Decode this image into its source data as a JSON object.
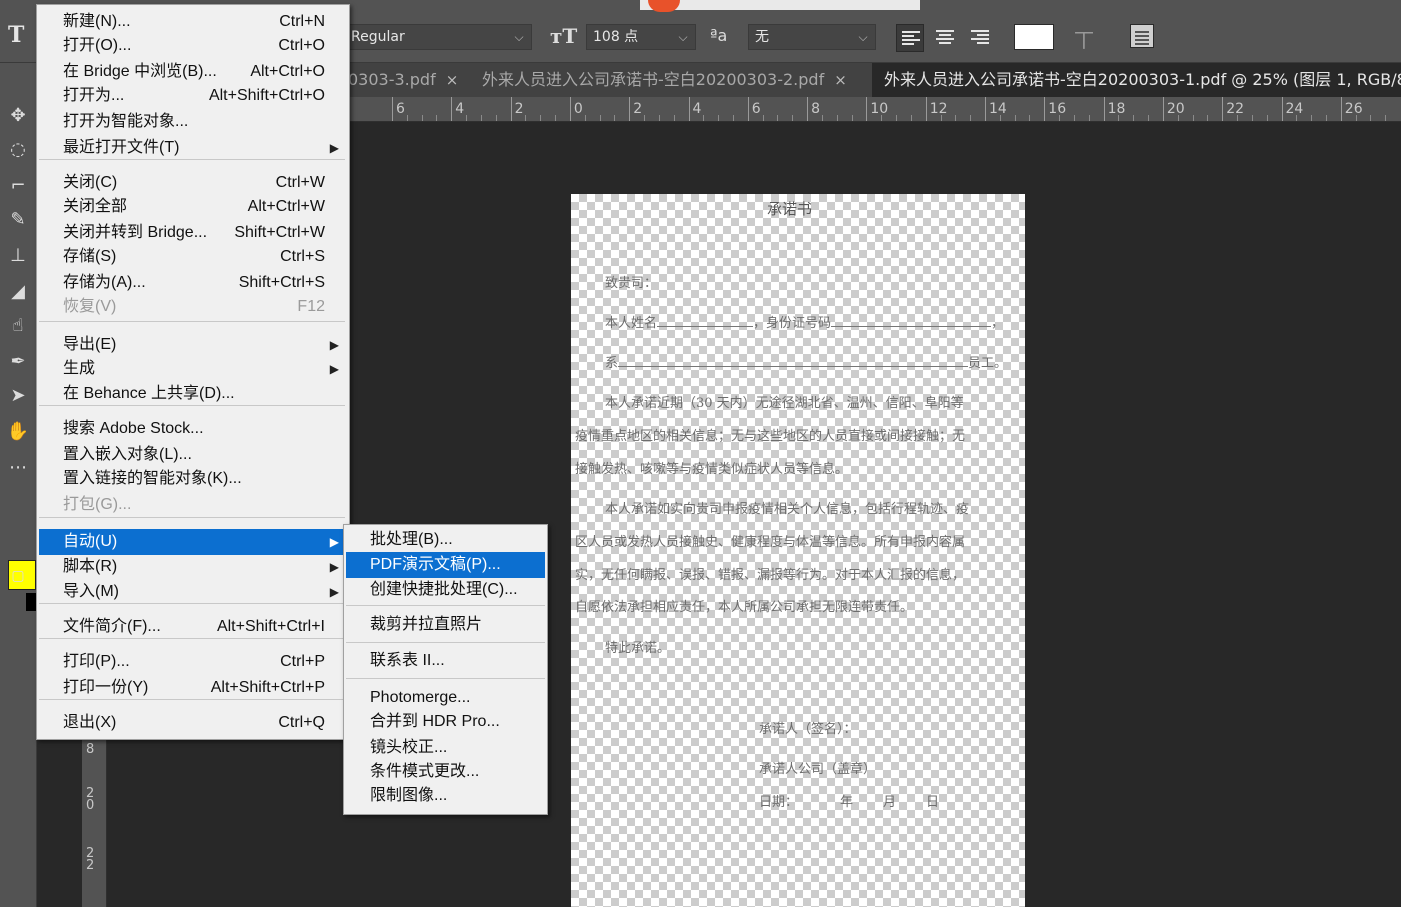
{
  "options_bar": {
    "font_style": "Regular",
    "font_size": "108 点",
    "antialias": "无",
    "color": "#ffffff"
  },
  "tabs": [
    {
      "label": "0303-3.pdf",
      "close": "×"
    },
    {
      "label": "外来人员进入公司承诺书-空白20200303-2.pdf",
      "close": "×"
    },
    {
      "label": "外来人员进入公司承诺书-空白20200303-1.pdf @ 25% (图层 1, RGB/8"
    }
  ],
  "ruler_h": [
    "6",
    "4",
    "2",
    "0",
    "2",
    "4",
    "6",
    "8",
    "10",
    "12",
    "14",
    "16",
    "18",
    "20",
    "22",
    "24",
    "26"
  ],
  "ruler_v": [
    "8",
    "2\n0",
    "2\n2"
  ],
  "file_menu": {
    "items": [
      {
        "label": "新建(N)...",
        "shortcut": "Ctrl+N"
      },
      {
        "label": "打开(O)...",
        "shortcut": "Ctrl+O"
      },
      {
        "label": "在 Bridge 中浏览(B)...",
        "shortcut": "Alt+Ctrl+O"
      },
      {
        "label": "打开为...",
        "shortcut": "Alt+Shift+Ctrl+O"
      },
      {
        "label": "打开为智能对象...",
        "shortcut": ""
      },
      {
        "label": "最近打开文件(T)",
        "shortcut": ""
      },
      {
        "label": "关闭(C)",
        "shortcut": "Ctrl+W"
      },
      {
        "label": "关闭全部",
        "shortcut": "Alt+Ctrl+W"
      },
      {
        "label": "关闭并转到 Bridge...",
        "shortcut": "Shift+Ctrl+W"
      },
      {
        "label": "存储(S)",
        "shortcut": "Ctrl+S"
      },
      {
        "label": "存储为(A)...",
        "shortcut": "Shift+Ctrl+S"
      },
      {
        "label": "恢复(V)",
        "shortcut": "F12"
      },
      {
        "label": "导出(E)",
        "shortcut": ""
      },
      {
        "label": "生成",
        "shortcut": ""
      },
      {
        "label": "在 Behance 上共享(D)...",
        "shortcut": ""
      },
      {
        "label": "搜索 Adobe Stock...",
        "shortcut": ""
      },
      {
        "label": "置入嵌入对象(L)...",
        "shortcut": ""
      },
      {
        "label": "置入链接的智能对象(K)...",
        "shortcut": ""
      },
      {
        "label": "打包(G)...",
        "shortcut": ""
      },
      {
        "label": "自动(U)",
        "shortcut": ""
      },
      {
        "label": "脚本(R)",
        "shortcut": ""
      },
      {
        "label": "导入(M)",
        "shortcut": ""
      },
      {
        "label": "文件简介(F)...",
        "shortcut": "Alt+Shift+Ctrl+I"
      },
      {
        "label": "打印(P)...",
        "shortcut": "Ctrl+P"
      },
      {
        "label": "打印一份(Y)",
        "shortcut": "Alt+Shift+Ctrl+P"
      },
      {
        "label": "退出(X)",
        "shortcut": "Ctrl+Q"
      }
    ]
  },
  "auto_submenu": {
    "items": [
      {
        "label": "批处理(B)..."
      },
      {
        "label": "PDF演示文稿(P)..."
      },
      {
        "label": "创建快捷批处理(C)..."
      },
      {
        "label": "裁剪并拉直照片"
      },
      {
        "label": "联系表 II..."
      },
      {
        "label": "Photomerge..."
      },
      {
        "label": "合并到 HDR Pro..."
      },
      {
        "label": "镜头校正..."
      },
      {
        "label": "条件模式更改..."
      },
      {
        "label": "限制图像..."
      }
    ]
  },
  "document": {
    "title": "承诺书",
    "greeting": "致贵司：",
    "line1_a": "本人姓名",
    "line1_b": "，身份证号码",
    "line2_a": "系",
    "line2_b": "员工。",
    "p1_l1": "本人承诺近期（30 天内）无途径湖北省、温州、信阳、阜阳等",
    "p1_l2": "疫情重点地区的相关信息；无与这些地区的人员直接或间接接触；无",
    "p1_l3": "接触发热、咳嗽等与疫情类似症状人员等信息。",
    "p2_l1": "本人承诺如实向贵司申报疫情相关个人信息，包括行程轨迹、疫",
    "p2_l2": "区人员或发热人员接触史、健康程度与体温等信息。所有申报内容属",
    "p2_l3": "实，无任何瞒报、误报、错报、漏报等行为。对于本人汇报的信息，",
    "p2_l4": "自愿依法承担相应责任，本人所属公司承担无限连带责任。",
    "closing": "特此承诺。",
    "sign": "承诺人（签名）：",
    "company": "承诺人公司（盖章）",
    "date_label": "日期：",
    "date_y": "年",
    "date_m": "月",
    "date_d": "日"
  }
}
